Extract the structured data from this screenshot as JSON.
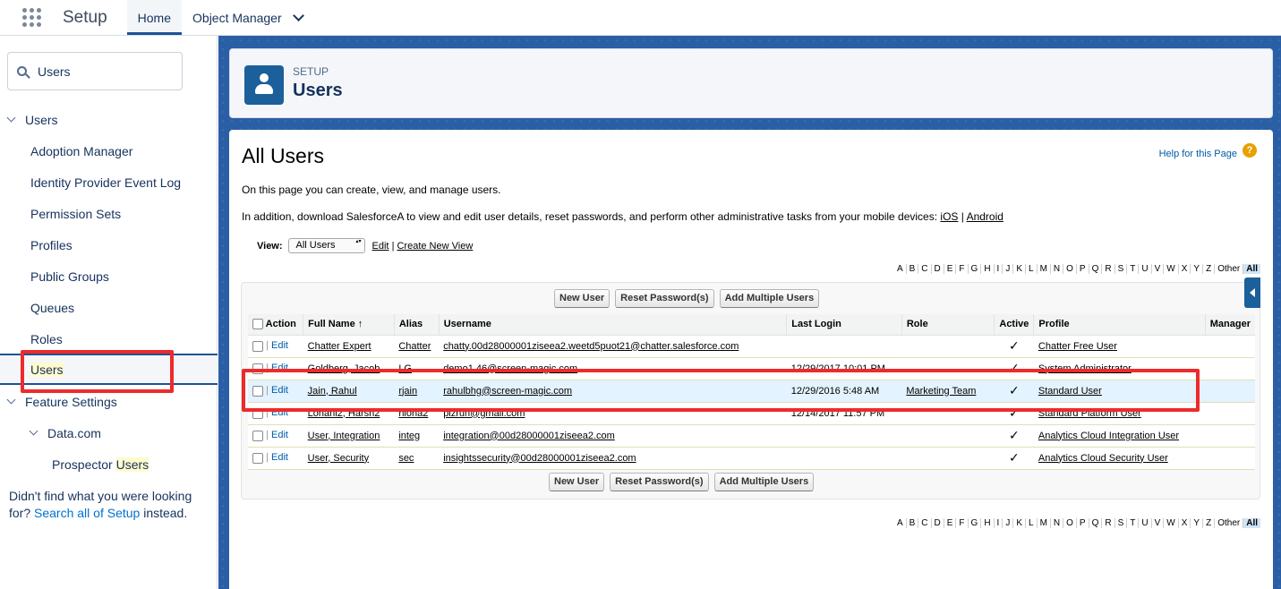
{
  "topnav": {
    "app_name": "Setup",
    "tabs": [
      {
        "label": "Home",
        "active": true
      },
      {
        "label": "Object Manager"
      }
    ]
  },
  "sidebar": {
    "search_value": "Users",
    "tree": [
      {
        "label": "Users",
        "level": 0,
        "expanded": true
      },
      {
        "label": "Adoption Manager",
        "level": 1
      },
      {
        "label": "Identity Provider Event Log",
        "level": 1
      },
      {
        "label": "Permission Sets",
        "level": 1
      },
      {
        "label": "Profiles",
        "level": 1
      },
      {
        "label": "Public Groups",
        "level": 1
      },
      {
        "label": "Queues",
        "level": 1
      },
      {
        "label": "Roles",
        "level": 1
      },
      {
        "label": "Users",
        "level": 1,
        "selected": true
      },
      {
        "label": "Feature Settings",
        "level": 0,
        "expanded": true
      },
      {
        "label": "Data.com",
        "level": 1,
        "expanded": true
      },
      {
        "label_prefix": "Prospector ",
        "label_highlight": "Users",
        "level": 2
      }
    ],
    "not_found_text": "Didn't find what you were looking for?",
    "not_found_link": "Search all of Setup",
    "not_found_suffix": "instead."
  },
  "header": {
    "super": "SETUP",
    "title": "Users"
  },
  "content": {
    "title": "All Users",
    "help_link": "Help for this Page",
    "desc1": "On this page you can create, view, and manage users.",
    "desc2_prefix": "In addition, download SalesforceA to view and edit user details, reset passwords, and perform other administrative tasks from your mobile devices:",
    "desc2_ios": "iOS",
    "desc2_sep": "|",
    "desc2_android": "Android",
    "view_label": "View:",
    "view_selected": "All Users",
    "view_edit": "Edit",
    "view_sep": "|",
    "view_create": "Create New View",
    "alphabet": [
      "A",
      "B",
      "C",
      "D",
      "E",
      "F",
      "G",
      "H",
      "I",
      "J",
      "K",
      "L",
      "M",
      "N",
      "O",
      "P",
      "Q",
      "R",
      "S",
      "T",
      "U",
      "V",
      "W",
      "X",
      "Y",
      "Z",
      "Other",
      "All"
    ],
    "buttons": {
      "new_user": "New User",
      "reset_password": "Reset Password(s)",
      "add_multiple": "Add Multiple Users"
    },
    "columns": {
      "action": "Action",
      "full_name": "Full Name",
      "sort_indicator": "↑",
      "alias": "Alias",
      "username": "Username",
      "last_login": "Last Login",
      "role": "Role",
      "active": "Active",
      "profile": "Profile",
      "manager": "Manager"
    },
    "edit_label": "Edit",
    "action_sep": "|",
    "check_mark": "✓",
    "rows": [
      {
        "full_name": "Chatter Expert",
        "alias": "Chatter",
        "username": "chatty.00d28000001ziseea2.weetd5puot21@chatter.salesforce.com",
        "last_login": "",
        "role": "",
        "active": "✓",
        "profile": "Chatter Free User"
      },
      {
        "full_name": "Goldberg, Jacob",
        "alias": "LG",
        "username": "demo1.46@screen-magic.com",
        "last_login": "12/29/2017 10:01 PM",
        "role": "",
        "active": "✓",
        "profile": "System Administrator"
      },
      {
        "full_name": "Jain, Rahul",
        "alias": "rjain",
        "username": "rahulbhg@screen-magic.com",
        "last_login": "12/29/2016 5:48 AM",
        "role": "Marketing Team",
        "active": "✓",
        "profile": "Standard User"
      },
      {
        "full_name": "Lohani2, Harsh2",
        "alias": "hloha2",
        "username": "pizrun@gmail.com",
        "last_login": "12/14/2017 11:57 PM",
        "role": "",
        "active": "✓",
        "profile": "Standard Platform User"
      },
      {
        "full_name": "User, Integration",
        "alias": "integ",
        "username": "integration@00d28000001ziseea2.com",
        "last_login": "",
        "role": "",
        "active": "✓",
        "profile": "Analytics Cloud Integration User"
      },
      {
        "full_name": "User, Security",
        "alias": "sec",
        "username": "insightssecurity@00d28000001ziseea2.com",
        "last_login": "",
        "role": "",
        "active": "✓",
        "profile": "Analytics Cloud Security User"
      }
    ]
  },
  "colors": {
    "brand_blue": "#1b5f9b",
    "link_blue": "#0070d2",
    "annotation_red": "#ee2a2a",
    "row_hover": "#e3f3ff"
  }
}
